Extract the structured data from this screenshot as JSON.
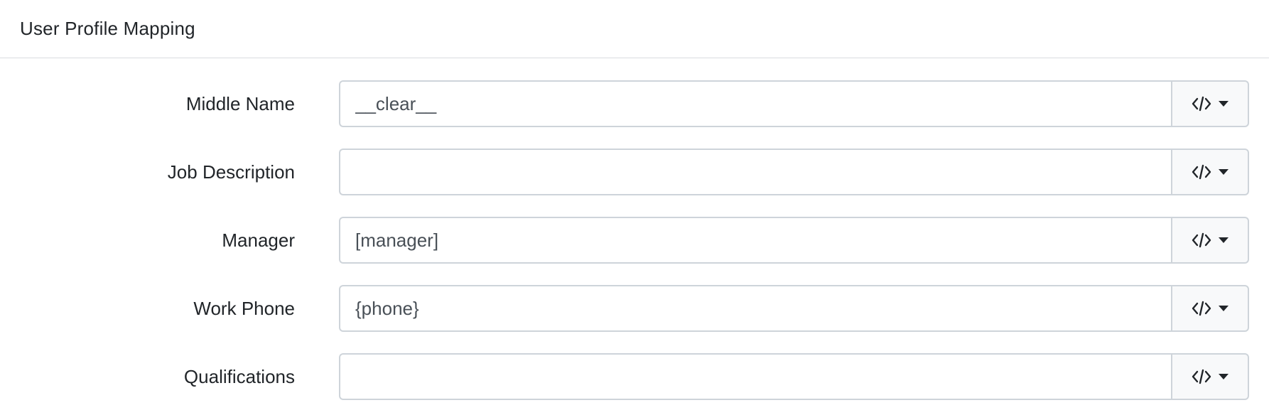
{
  "header": {
    "title": "User Profile Mapping"
  },
  "fields": [
    {
      "label": "Middle Name",
      "value": "__clear__",
      "addon_icon": "code-icon",
      "addon_caret": "caret-down-icon"
    },
    {
      "label": "Job Description",
      "value": "",
      "addon_icon": "code-icon",
      "addon_caret": "caret-down-icon"
    },
    {
      "label": "Manager",
      "value": "[manager]",
      "addon_icon": "code-icon",
      "addon_caret": "caret-down-icon"
    },
    {
      "label": "Work Phone",
      "value": "{phone}",
      "addon_icon": "code-icon",
      "addon_caret": "caret-down-icon"
    },
    {
      "label": "Qualifications",
      "value": "",
      "addon_icon": "code-icon",
      "addon_caret": "caret-down-icon"
    }
  ],
  "colors": {
    "border": "#ced4da",
    "addon_bg": "#f8f9fa",
    "text": "#212529",
    "input_text": "#495057"
  }
}
